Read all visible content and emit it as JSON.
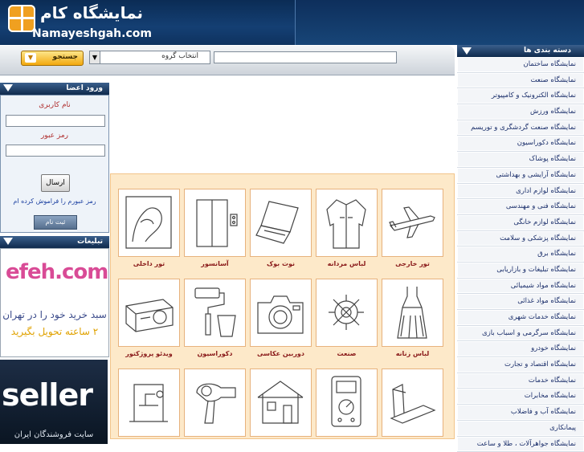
{
  "brand": {
    "name_fa": "نمایشگاه کام",
    "name_en": "Namayeshgah.com"
  },
  "search": {
    "input_value": "",
    "group_label": "انتخاب گروه",
    "button_label": "جستجو"
  },
  "login": {
    "title": "ورود اعضا",
    "username_label": "نام کاربری",
    "password_label": "رمز عبور",
    "submit_label": "ارسال",
    "forgot_label": "رمز عبورم را فراموش کرده ام",
    "register_label": "ثبت نام"
  },
  "ads": {
    "title": "تبلیغات",
    "ad1": {
      "brand": "efeh.com",
      "line1": "سبد خرید خود را در تهران",
      "line2": "۲ ساعته تحویل بگیرید"
    },
    "ad2": {
      "brand": "seller",
      "line1": "سایت فروشندگان ایران"
    }
  },
  "categories": {
    "title": "دسته بندی ها",
    "items": [
      "نمایشگاه ساختمان",
      "نمایشگاه صنعت",
      "نمایشگاه الکترونیک و کامپیوتر",
      "نمایشگاه ورزش",
      "نمایشگاه صنعت گردشگری و توریسم",
      "نمایشگاه دکوراسیون",
      "نمایشگاه پوشاک",
      "نمایشگاه آرایشی و بهداشتی",
      "نمایشگاه لوازم اداری",
      "نمایشگاه فنی و مهندسی",
      "نمایشگاه لوازم خانگی",
      "نمایشگاه پزشکی و سلامت",
      "نمایشگاه برق",
      "نمایشگاه تبلیغات و بازاریابی",
      "نمایشگاه مواد شیمیائی",
      "نمایشگاه مواد غذائی",
      "نمایشگاه خدمات شهری",
      "نمایشگاه سرگرمی و اسباب بازی",
      "نمایشگاه خودرو",
      "نمایشگاه اقتصاد و تجارت",
      "نمایشگاه خدمات",
      "نمایشگاه مخابرات",
      "نمایشگاه آب و فاضلاب",
      "پیمانکاری",
      "نمایشگاه جواهرآلات ، طلا و ساعت"
    ]
  },
  "grid": {
    "items": [
      {
        "label": "تور خارجی",
        "icon": "airplane-icon"
      },
      {
        "label": "لباس مردانه",
        "icon": "jacket-icon"
      },
      {
        "label": "نوت بوک",
        "icon": "laptop-icon"
      },
      {
        "label": "آسانسور",
        "icon": "elevator-icon"
      },
      {
        "label": "تور داخلی",
        "icon": "relief-icon"
      },
      {
        "label": "لباس زنانه",
        "icon": "dress-icon"
      },
      {
        "label": "صنعت",
        "icon": "gear-tools-icon"
      },
      {
        "label": "دوربین عکاسی",
        "icon": "camera-icon"
      },
      {
        "label": "دکوراسیون",
        "icon": "paint-roller-icon"
      },
      {
        "label": "ویدئو پروژکتور",
        "icon": "projector-icon"
      },
      {
        "label": "",
        "icon": "treadmill-icon"
      },
      {
        "label": "",
        "icon": "multimeter-icon"
      },
      {
        "label": "",
        "icon": "house-icon"
      },
      {
        "label": "",
        "icon": "hair-dryer-icon"
      },
      {
        "label": "",
        "icon": "gym-machine-icon"
      }
    ]
  }
}
